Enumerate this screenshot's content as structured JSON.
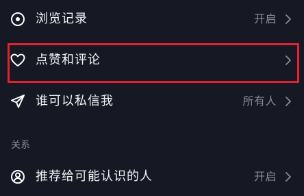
{
  "settings": {
    "rows": [
      {
        "label": "浏览记录",
        "value": "开启",
        "icon": "eye-icon"
      },
      {
        "label": "点赞和评论",
        "value": "",
        "icon": "heart-icon"
      },
      {
        "label": "谁可以私信我",
        "value": "所有人",
        "icon": "send-icon"
      }
    ],
    "section_header": "关系",
    "relation_rows": [
      {
        "label": "推荐给可能认识的人",
        "value": "开启",
        "icon": "person-circle-icon"
      }
    ]
  },
  "colors": {
    "background": "#161823",
    "text": "#f2f2f4",
    "muted": "#8b8c94",
    "highlight": "#e0232e"
  }
}
